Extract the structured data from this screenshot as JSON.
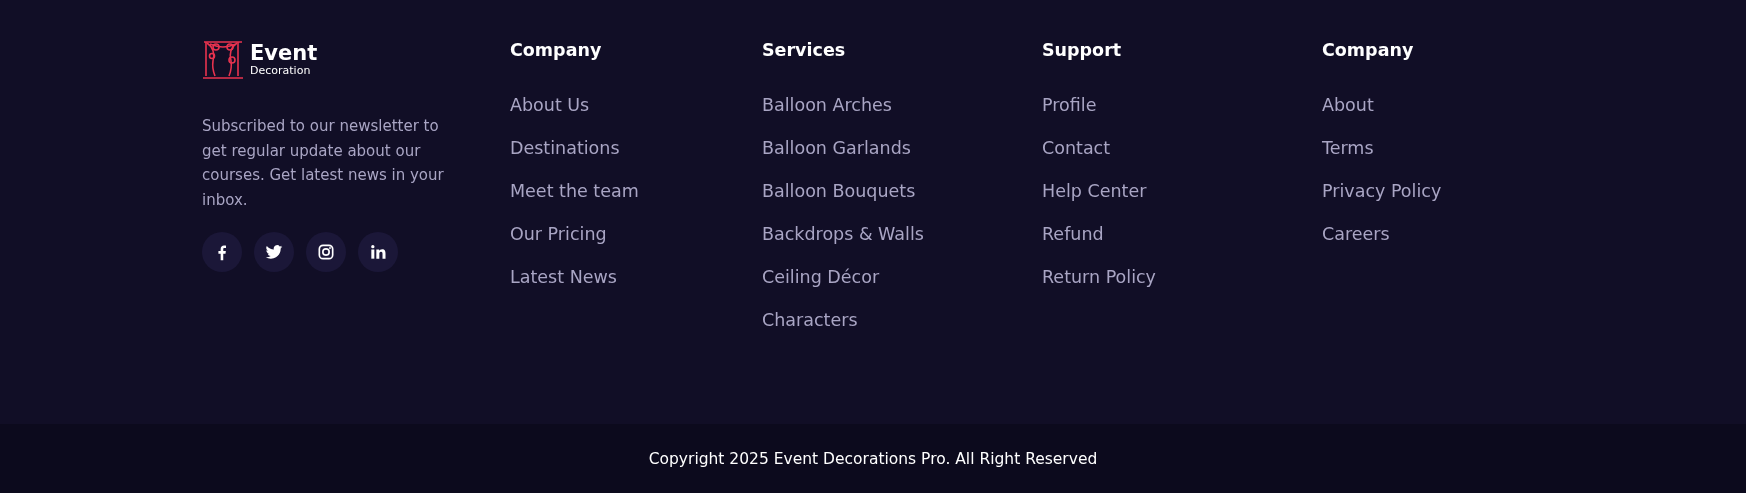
{
  "brand": {
    "name": "Event",
    "tagline": "Decoration"
  },
  "newsletter_text": "Subscribed to our newsletter to get regular update about our courses. Get latest news in your inbox.",
  "social_links": [
    {
      "kind": "facebook"
    },
    {
      "kind": "twitter"
    },
    {
      "kind": "instagram"
    },
    {
      "kind": "linkedin"
    }
  ],
  "columns": [
    {
      "heading": "Company",
      "links": [
        "About Us",
        "Destinations",
        "Meet the team",
        "Our Pricing",
        "Latest News"
      ]
    },
    {
      "heading": "Services",
      "links": [
        "Balloon Arches",
        "Balloon Garlands",
        "Balloon Bouquets",
        "Backdrops & Walls",
        "Ceiling Décor",
        "Characters"
      ]
    },
    {
      "heading": "Support",
      "links": [
        "Profile",
        "Contact",
        "Help Center",
        "Refund",
        "Return Policy"
      ]
    },
    {
      "heading": "Company",
      "links": [
        "About",
        "Terms",
        "Privacy Policy",
        "Careers"
      ]
    }
  ],
  "copyright": "Copyright 2025 Event Decorations Pro. All Right Reserved"
}
